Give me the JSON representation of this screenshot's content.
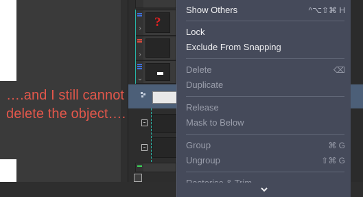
{
  "annotation": "….and I still cannot delete the object….",
  "layers": {
    "top_glyph": "?",
    "colors": {
      "blue": "#3d6fd8",
      "red": "#d84a3d",
      "green": "#3dd85a",
      "teal": "#26b6a6",
      "selection": "#4c5f78"
    }
  },
  "menu": {
    "items": [
      {
        "label": "Show Others",
        "shortcut": "^⌥⇧⌘ H",
        "enabled": true
      },
      {
        "label": "Lock",
        "shortcut": "",
        "enabled": true
      },
      {
        "label": "Exclude From Snapping",
        "shortcut": "",
        "enabled": true
      },
      {
        "label": "Delete",
        "shortcut": "⌫",
        "enabled": false
      },
      {
        "label": "Duplicate",
        "shortcut": "",
        "enabled": false
      },
      {
        "label": "Release",
        "shortcut": "",
        "enabled": false
      },
      {
        "label": "Mask to Below",
        "shortcut": "",
        "enabled": false
      },
      {
        "label": "Group",
        "shortcut": "⌘ G",
        "enabled": false
      },
      {
        "label": "Ungroup",
        "shortcut": "⇧⌘ G",
        "enabled": false
      },
      {
        "label": "Rasterise & Trim…",
        "shortcut": "",
        "enabled": false
      }
    ],
    "scroll_indicator": "chevron-down-icon"
  }
}
